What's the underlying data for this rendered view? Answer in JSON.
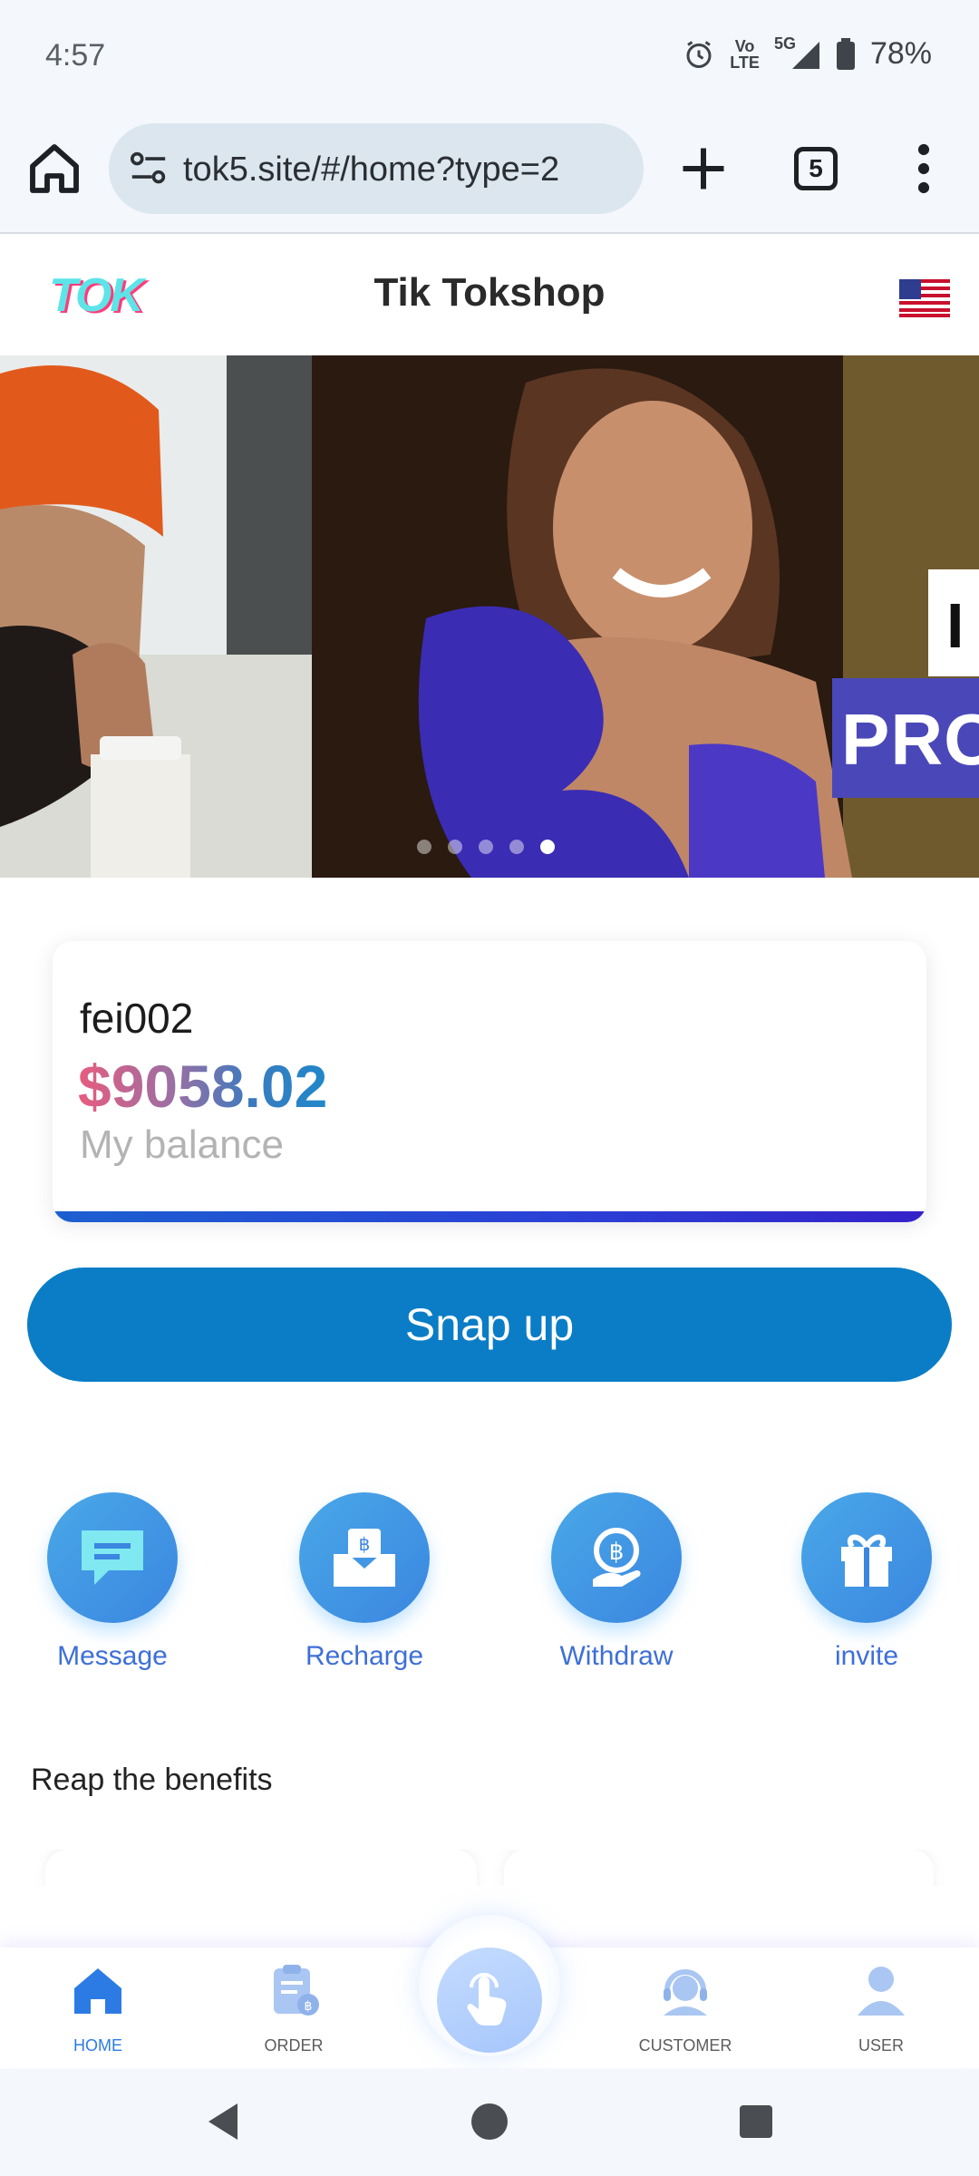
{
  "status_bar": {
    "time": "4:57",
    "network_top": "Vo",
    "network_bottom": "LTE",
    "network_gen": "5G",
    "battery": "78%"
  },
  "browser": {
    "url": "tok5.site/#/home?type=2",
    "tab_count": "5"
  },
  "header": {
    "logo_text": "TOK",
    "title": "Tik Tokshop"
  },
  "banner": {
    "slide_count": 5,
    "active_slide": 5,
    "overlay_text": "PRO",
    "overlay_text_2": "I"
  },
  "account": {
    "username": "fei002",
    "balance": "$9058.02",
    "balance_label": "My balance"
  },
  "snap_button": "Snap up",
  "actions": [
    {
      "label": "Message",
      "icon": "message-icon"
    },
    {
      "label": "Recharge",
      "icon": "recharge-icon"
    },
    {
      "label": "Withdraw",
      "icon": "withdraw-icon"
    },
    {
      "label": "invite",
      "icon": "gift-icon"
    }
  ],
  "section_title": "Reap the benefits",
  "bottom_nav": [
    {
      "label": "HOME",
      "icon": "home-icon",
      "active": true
    },
    {
      "label": "ORDER",
      "icon": "order-icon",
      "active": false
    },
    {
      "label": "CUSTOMER",
      "icon": "customer-service-icon",
      "active": false
    },
    {
      "label": "USER",
      "icon": "user-icon",
      "active": false
    }
  ],
  "colors": {
    "primary": "#0a7dc6",
    "accent_blue": "#3e6fd8",
    "nav_active": "#2c7be5"
  }
}
